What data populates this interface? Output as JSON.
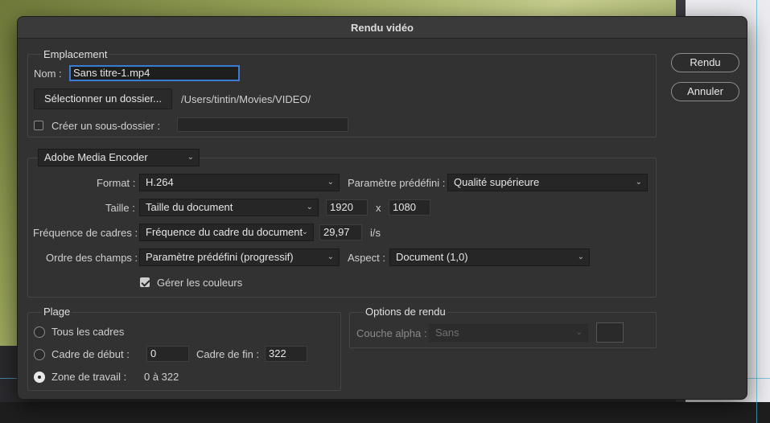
{
  "dialog": {
    "title": "Rendu vidéo",
    "render_button": "Rendu",
    "cancel_button": "Annuler"
  },
  "location": {
    "title": "Emplacement",
    "name_label": "Nom :",
    "name_value": "Sans titre-1.mp4",
    "select_folder_button": "Sélectionner un dossier...",
    "folder_path": "/Users/tintin/Movies/VIDEO/",
    "subfolder_label": "Créer un sous-dossier :",
    "subfolder_checked": false,
    "subfolder_value": ""
  },
  "encoder": {
    "selected": "Adobe Media Encoder",
    "format_label": "Format :",
    "format_value": "H.264",
    "preset_label": "Paramètre prédéfini :",
    "preset_value": "Qualité supérieure",
    "size_label": "Taille :",
    "size_value": "Taille du document",
    "width": "1920",
    "size_separator": "x",
    "height": "1080",
    "framerate_label": "Fréquence de cadres :",
    "framerate_value": "Fréquence du cadre du document",
    "framerate_number": "29,97",
    "framerate_unit": "i/s",
    "field_order_label": "Ordre des champs :",
    "field_order_value": "Paramètre prédéfini (progressif)",
    "aspect_label": "Aspect :",
    "aspect_value": "Document (1,0)",
    "color_manage_label": "Gérer les couleurs",
    "color_manage_checked": true
  },
  "range": {
    "title": "Plage",
    "all_frames_label": "Tous les cadres",
    "start_frame_label": "Cadre de début :",
    "start_frame_value": "0",
    "end_frame_label": "Cadre de fin :",
    "end_frame_value": "322",
    "work_area_label": "Zone de travail :",
    "work_area_value": "0 à 322",
    "selected": "work_area"
  },
  "render_options": {
    "title": "Options de rendu",
    "alpha_label": "Couche alpha :",
    "alpha_value": "Sans"
  }
}
